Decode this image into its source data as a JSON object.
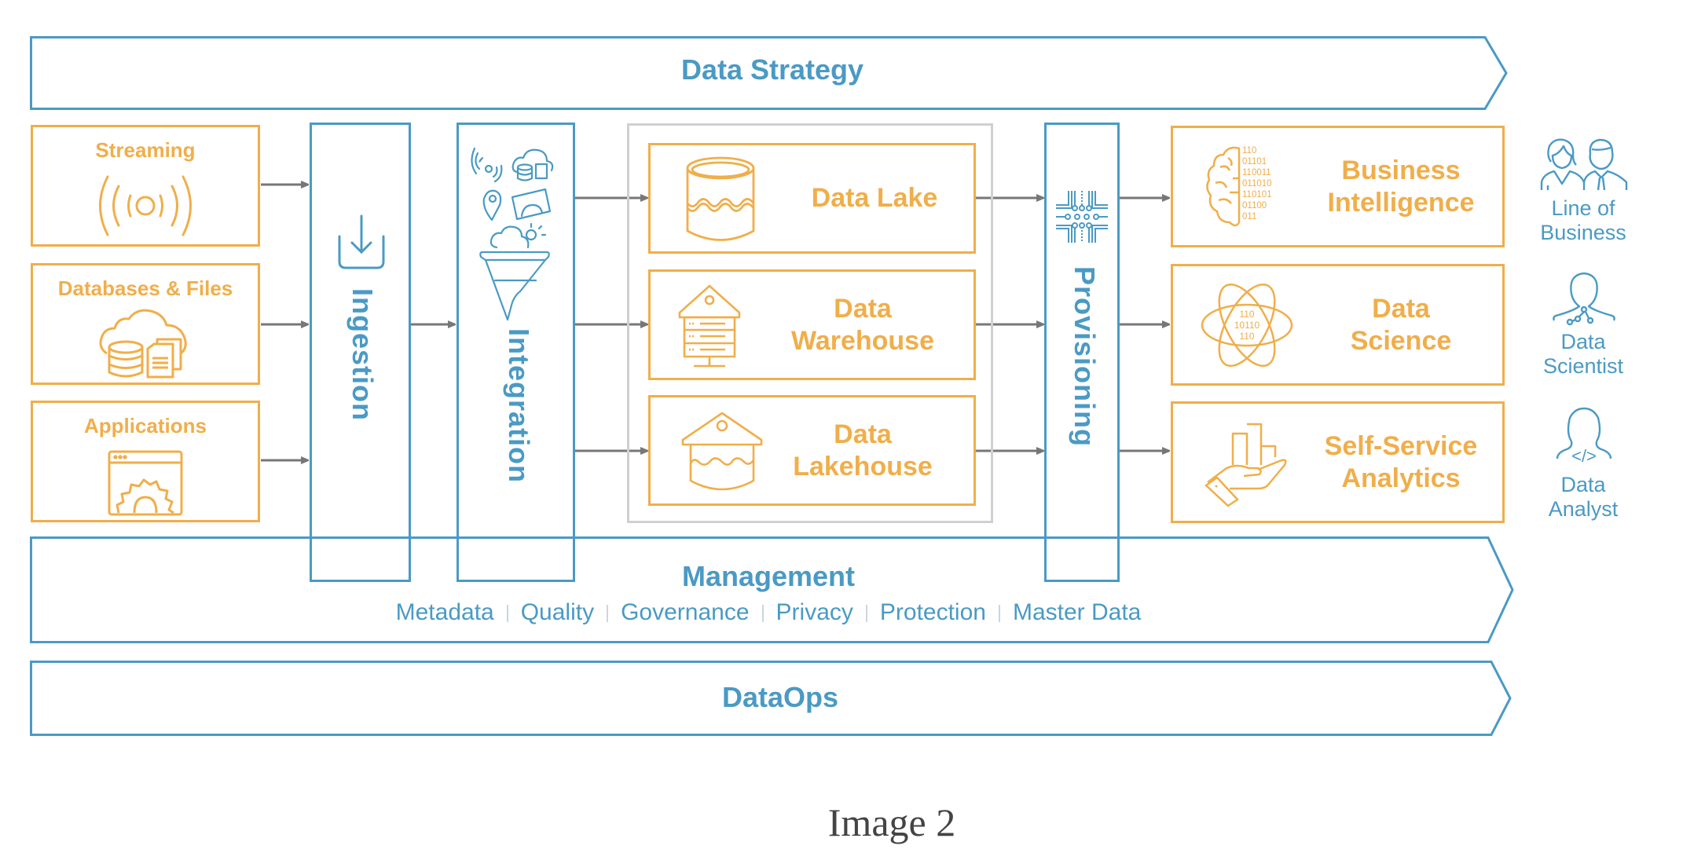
{
  "caption": "Image 2",
  "colors": {
    "accent_blue": "#4A9AC4",
    "accent_orange": "#F0AE4A",
    "arrow_gray": "#777777",
    "container_gray": "#D0D0D0"
  },
  "banners": {
    "strategy": {
      "label": "Data Strategy"
    },
    "management": {
      "label": "Management",
      "items": [
        "Metadata",
        "Quality",
        "Governance",
        "Privacy",
        "Protection",
        "Master Data"
      ]
    },
    "dataops": {
      "label": "DataOps"
    }
  },
  "sources": [
    {
      "label": "Streaming",
      "icon": "broadcast-icon"
    },
    {
      "label": "Databases & Files",
      "icon": "cloud-database-files-icon"
    },
    {
      "label": "Applications",
      "icon": "app-settings-icon"
    }
  ],
  "stages": {
    "ingestion": {
      "label": "Ingestion",
      "icon": "download-tray-icon"
    },
    "integration": {
      "label": "Integration",
      "icon": "data-funnel-icon"
    },
    "provisioning": {
      "label": "Provisioning",
      "icon": "circuit-chip-icon"
    }
  },
  "storage": [
    {
      "label_line1": "Data Lake",
      "label_line2": "",
      "icon": "lake-cylinder-icon"
    },
    {
      "label_line1": "Data",
      "label_line2": "Warehouse",
      "icon": "warehouse-server-icon"
    },
    {
      "label_line1": "Data",
      "label_line2": "Lakehouse",
      "icon": "lakehouse-icon"
    }
  ],
  "consumers": [
    {
      "label_line1": "Business",
      "label_line2": "Intelligence",
      "icon": "brain-binary-icon",
      "binary": [
        "110",
        "01101",
        "110011",
        "011010",
        "110101",
        "01100",
        "011"
      ]
    },
    {
      "label_line1": "Data",
      "label_line2": "Science",
      "icon": "atom-binary-icon",
      "binary": [
        "110",
        "10110",
        "110"
      ]
    },
    {
      "label_line1": "Self-Service",
      "label_line2": "Analytics",
      "icon": "hand-chart-icon"
    }
  ],
  "personas": [
    {
      "label_line1": "Line of",
      "label_line2": "Business",
      "icon": "business-people-icon"
    },
    {
      "label_line1": "Data",
      "label_line2": "Scientist",
      "icon": "scientist-person-icon"
    },
    {
      "label_line1": "Data",
      "label_line2": "Analyst",
      "icon": "analyst-person-icon",
      "code_glyph": "</>"
    }
  ]
}
